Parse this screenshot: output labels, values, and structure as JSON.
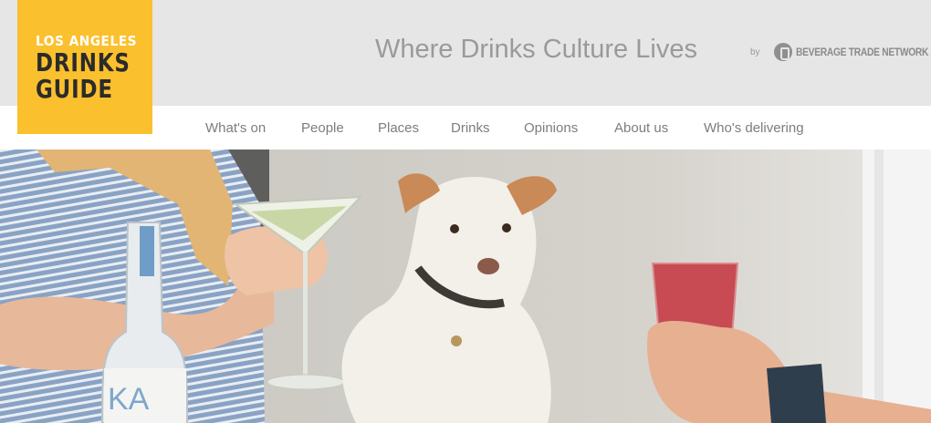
{
  "logo": {
    "line1": "LOS ANGELES",
    "line2": "DRINKS",
    "line3": "GUIDE",
    "background": "#fbc02d"
  },
  "header": {
    "tagline": "Where Drinks Culture Lives",
    "by_label": "by",
    "partner_name": "BEVERAGE TRADE NETWORK"
  },
  "nav": {
    "items": [
      {
        "label": "What's on"
      },
      {
        "label": "People"
      },
      {
        "label": "Places"
      },
      {
        "label": "Drinks"
      },
      {
        "label": "Opinions"
      },
      {
        "label": "About us"
      },
      {
        "label": "Who's delivering"
      }
    ]
  },
  "hero": {
    "bottle_label_text": "KA"
  },
  "colors": {
    "header_bg": "#e6e6e6",
    "nav_text": "#7d7d7d",
    "tagline_text": "#9a9a9a"
  }
}
